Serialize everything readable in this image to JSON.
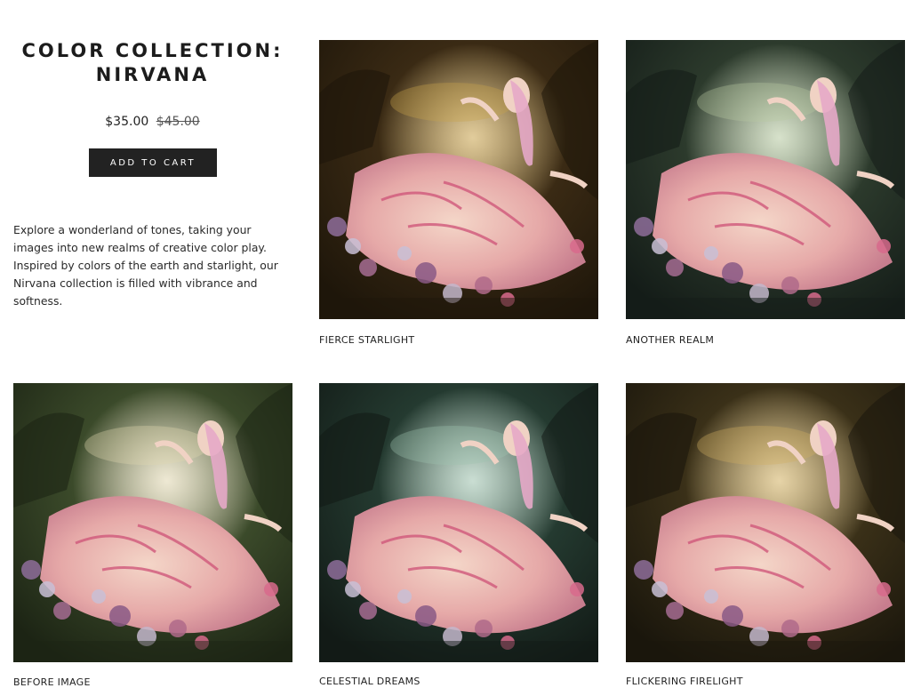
{
  "product": {
    "title_line1": "COLOR COLLECTION:",
    "title_line2": "NIRVANA",
    "price": "$35.00",
    "old_price": "$45.00",
    "add_to_cart_label": "ADD TO CART",
    "description": "Explore a wonderland of tones, taking your images into new realms of creative color play. Inspired by colors of the earth and starlight, our Nirvana collection is filled with vibrance and softness."
  },
  "gallery": [
    {
      "caption": "FIERCE STARLIGHT",
      "tint": "#3a2a14",
      "shade": "#1e160a",
      "glow": "#c9a24a"
    },
    {
      "caption": "ANOTHER REALM",
      "tint": "#2c3a2c",
      "shade": "#141c18",
      "glow": "#b6c9a0"
    },
    {
      "caption": "BEFORE IMAGE",
      "tint": "#3b4a2a",
      "shade": "#1c2414",
      "glow": "#e0d6b0"
    },
    {
      "caption": "CELESTIAL DREAMS",
      "tint": "#243a30",
      "shade": "#121a16",
      "glow": "#9ec2ae"
    },
    {
      "caption": "FLICKERING FIRELIGHT",
      "tint": "#3a3018",
      "shade": "#1a160c",
      "glow": "#d2b060"
    }
  ]
}
